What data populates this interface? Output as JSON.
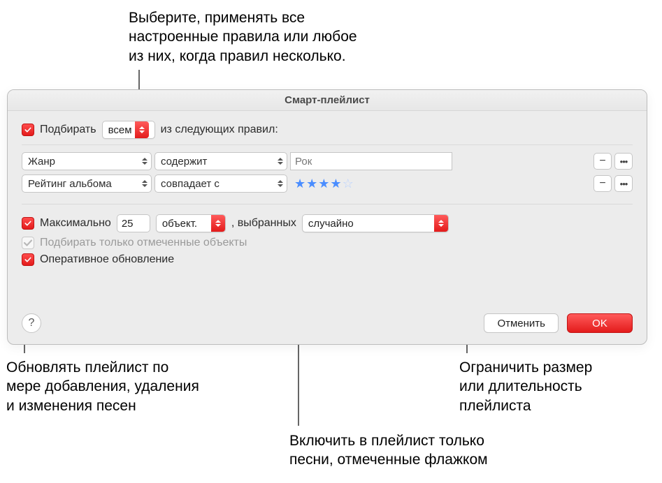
{
  "annotations": {
    "top": "Выберите, применять все\nнастроенные правила или любое\nиз них, когда правил несколько.",
    "bottom_left": "Обновлять плейлист по\nмере добавления, удаления\nи изменения песен",
    "bottom_right": "Ограничить размер\nили длительность\nплейлиста",
    "bottom_mid": "Включить в плейлист только\nпесни, отмеченные флажком"
  },
  "window": {
    "title": "Смарт-плейлист",
    "match": {
      "label_before": "Подбирать",
      "mode": "всем",
      "label_after": "из следующих правил:"
    },
    "rules": [
      {
        "field": "Жанр",
        "op": "содержит",
        "value": "Рок",
        "type": "text"
      },
      {
        "field": "Рейтинг альбома",
        "op": "совпадает с",
        "stars": 4,
        "type": "stars"
      }
    ],
    "limit": {
      "label": "Максимально",
      "count": "25",
      "unit": "объект.",
      "sel_label": ", выбранных",
      "method": "случайно"
    },
    "only_checked": {
      "label": "Подбирать только отмеченные объекты"
    },
    "live_update": {
      "label": "Оперативное обновление"
    },
    "buttons": {
      "help": "?",
      "cancel": "Отменить",
      "ok": "OK"
    },
    "icons": {
      "minus": "−",
      "more": "•••"
    }
  }
}
